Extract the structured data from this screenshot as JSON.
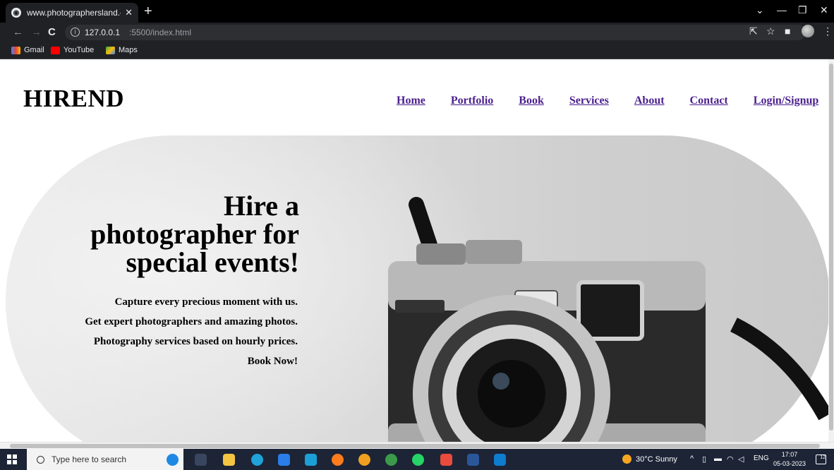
{
  "browser": {
    "tab_title": "www.photographersland.com",
    "url_host": "127.0.0.1",
    "url_path": ":5500/index.html",
    "bookmarks": [
      "Gmail",
      "YouTube",
      "Maps"
    ]
  },
  "site": {
    "logo": "HIREND",
    "nav": [
      "Home",
      "Portfolio",
      "Book",
      "Services",
      "About",
      "Contact",
      "Login/Signup"
    ],
    "hero": {
      "headline_lines": [
        "Hire a",
        "photographer for",
        "special events!"
      ],
      "sub_lines": [
        "Capture every precious moment with us.",
        "Get expert photographers and amazing photos.",
        "Photography services based on hourly prices.",
        "Book Now!"
      ]
    }
  },
  "taskbar": {
    "search_placeholder": "Type here to search",
    "weather": "30°C  Sunny",
    "language": "ENG",
    "time": "17:07",
    "date": "05-03-2023",
    "notification_count": "12"
  }
}
